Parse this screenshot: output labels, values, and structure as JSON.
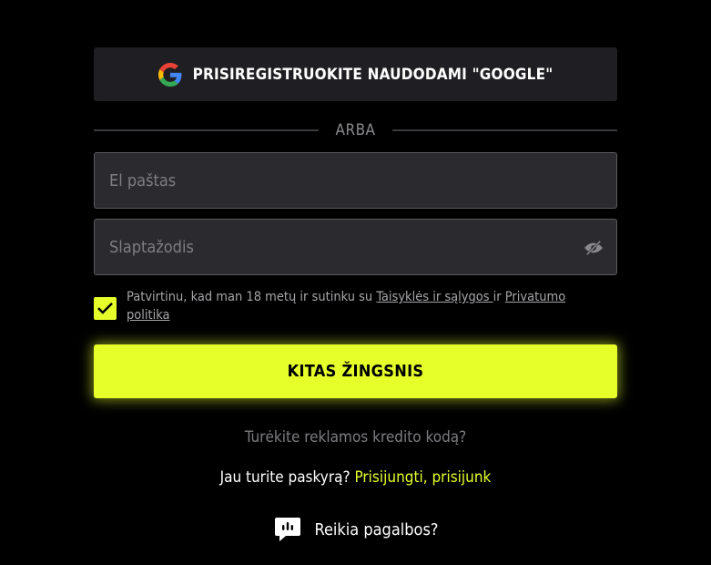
{
  "google_button": {
    "label": "PRISIREGISTRUOKITE NAUDODAMI \"GOOGLE\"",
    "icon": "google-icon"
  },
  "divider": {
    "text": "ARBA"
  },
  "email": {
    "placeholder": "El paštas",
    "value": ""
  },
  "password": {
    "placeholder": "Slaptažodis",
    "value": "",
    "icon": "eye-slash-icon"
  },
  "consent": {
    "checked": true,
    "prefix": "Patvirtinu, kad man 18 metų ir sutinku su ",
    "terms_link": "Taisyklės ir sąlygos ",
    "middle": "ir ",
    "privacy_link": "Privatumo politika"
  },
  "next_button": {
    "label": "KITAS ŽINGSNIS"
  },
  "promo_link": "Turėkite reklamos kredito kodą?",
  "login": {
    "prefix": "Jau turite paskyrą? ",
    "link": "Prisijungti, prisijunk"
  },
  "help": {
    "label": "Reikia pagalbos?",
    "icon": "chat-bubble-icon"
  },
  "colors": {
    "accent": "#e6ff2a",
    "background": "#000000",
    "input_bg": "#2b2b2f",
    "button_dark": "#1f1f23"
  }
}
